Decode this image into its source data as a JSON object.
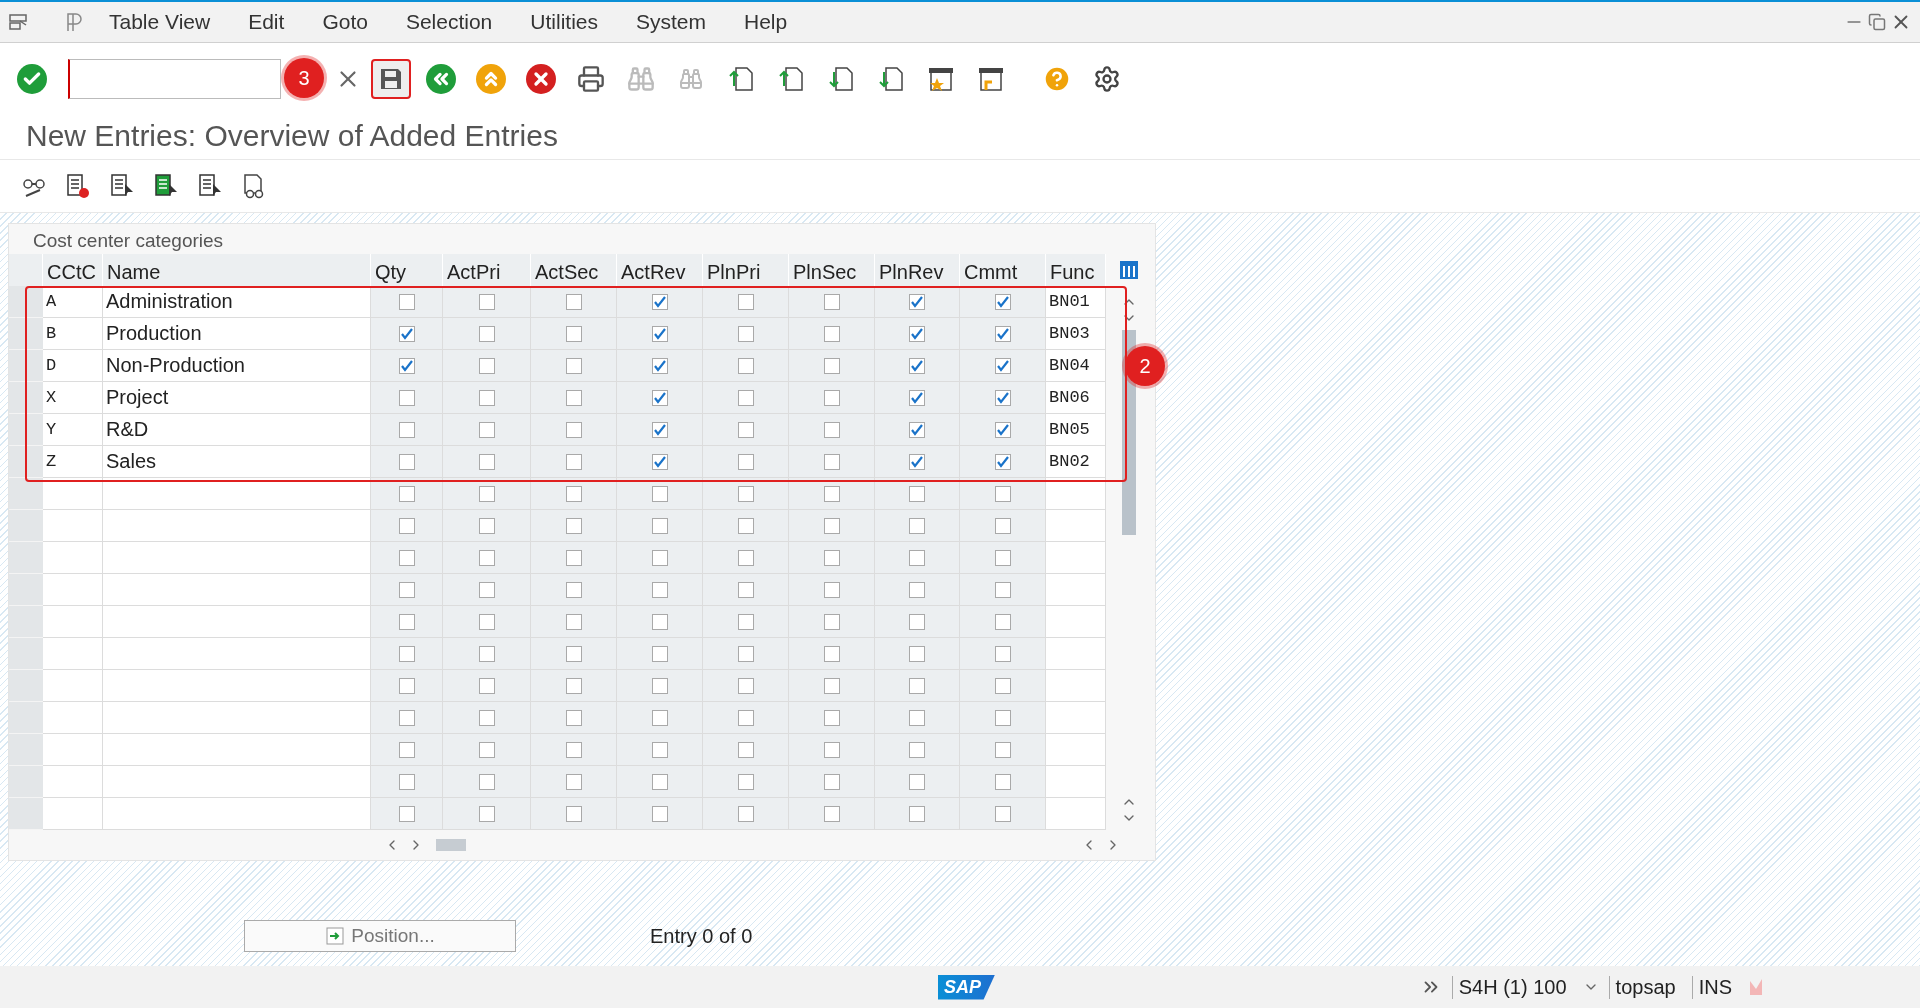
{
  "menu": [
    "Table View",
    "Edit",
    "Goto",
    "Selection",
    "Utilities",
    "System",
    "Help"
  ],
  "title": "New Entries: Overview of Added Entries",
  "table": {
    "caption": "Cost center categories",
    "columns": [
      "CCtC",
      "Name",
      "Qty",
      "ActPri",
      "ActSec",
      "ActRev",
      "PlnPri",
      "PlnSec",
      "PlnRev",
      "Cmmt",
      "Func"
    ],
    "rows": [
      {
        "code": "A",
        "name": "Administration",
        "checks": [
          false,
          false,
          false,
          true,
          false,
          false,
          true,
          true
        ],
        "func": "BN01"
      },
      {
        "code": "B",
        "name": "Production",
        "checks": [
          true,
          false,
          false,
          true,
          false,
          false,
          true,
          true
        ],
        "func": "BN03"
      },
      {
        "code": "D",
        "name": "Non-Production",
        "checks": [
          true,
          false,
          false,
          true,
          false,
          false,
          true,
          true
        ],
        "func": "BN04"
      },
      {
        "code": "X",
        "name": "Project",
        "checks": [
          false,
          false,
          false,
          true,
          false,
          false,
          true,
          true
        ],
        "func": "BN06"
      },
      {
        "code": "Y",
        "name": "R&D",
        "checks": [
          false,
          false,
          false,
          true,
          false,
          false,
          true,
          true
        ],
        "func": "BN05"
      },
      {
        "code": "Z",
        "name": "Sales",
        "checks": [
          false,
          false,
          false,
          true,
          false,
          false,
          true,
          true
        ],
        "func": "BN02"
      }
    ],
    "blank_rows": [
      {
        "checks": [
          false,
          false,
          false,
          false,
          false,
          false,
          false,
          false
        ]
      },
      {
        "checks": [
          false,
          false,
          false,
          false,
          false,
          false,
          false,
          false
        ]
      },
      {
        "checks": [
          false,
          false,
          false,
          false,
          false,
          false,
          false,
          false
        ]
      },
      {
        "checks": [
          false,
          false,
          false,
          false,
          false,
          false,
          false,
          false
        ]
      },
      {
        "checks": [
          false,
          false,
          false,
          false,
          false,
          false,
          false,
          false
        ]
      },
      {
        "checks": [
          false,
          false,
          false,
          false,
          false,
          false,
          false,
          false
        ]
      },
      {
        "checks": [
          false,
          false,
          false,
          false,
          false,
          false,
          false,
          false
        ]
      },
      {
        "checks": [
          false,
          false,
          false,
          false,
          false,
          false,
          false,
          false
        ]
      },
      {
        "checks": [
          false,
          false,
          false,
          false,
          false,
          false,
          false,
          false
        ]
      },
      {
        "checks": [
          false,
          false,
          false,
          false,
          false,
          false,
          false,
          false
        ]
      },
      {
        "checks": [
          false,
          false,
          false,
          false,
          false,
          false,
          false,
          false
        ]
      }
    ]
  },
  "annotations": [
    {
      "label": "3"
    },
    {
      "label": "2"
    }
  ],
  "position_button": "Position...",
  "entry_count": "Entry 0 of 0",
  "status_bar": {
    "logo": "SAP",
    "system": "S4H (1) 100",
    "user": "topsap",
    "mode": "INS"
  }
}
